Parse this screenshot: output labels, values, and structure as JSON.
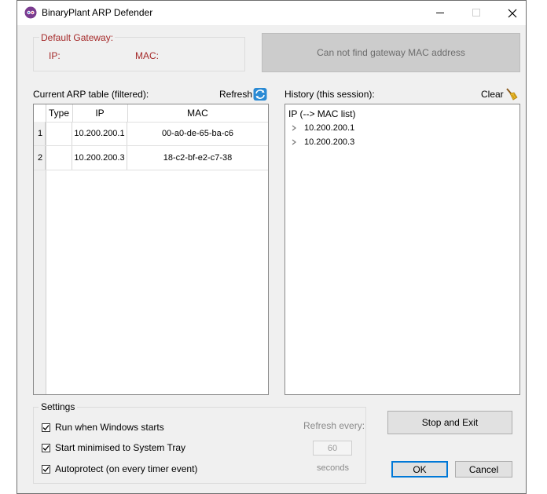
{
  "window": {
    "title": "BinaryPlant ARP Defender"
  },
  "gateway": {
    "legend": "Default Gateway:",
    "ip_label": "IP:",
    "mac_label": "MAC:",
    "status_message": "Can not find gateway MAC address"
  },
  "arp_table": {
    "label": "Current ARP table (filtered):",
    "refresh_label": "Refresh",
    "columns": {
      "type": "Type",
      "ip": "IP",
      "mac": "MAC"
    },
    "rows": [
      {
        "num": "1",
        "type": "",
        "ip": "10.200.200.1",
        "mac": "00-a0-de-65-ba-c6"
      },
      {
        "num": "2",
        "type": "",
        "ip": "10.200.200.3",
        "mac": "18-c2-bf-e2-c7-38"
      }
    ]
  },
  "history": {
    "label": "History (this session):",
    "clear_label": "Clear",
    "root_label": "IP (--> MAC list)",
    "items": [
      "10.200.200.1",
      "10.200.200.3"
    ]
  },
  "settings": {
    "legend": "Settings",
    "run_on_start": {
      "label": "Run when Windows starts",
      "checked": true
    },
    "start_minimised": {
      "label": "Start minimised to System Tray",
      "checked": true
    },
    "autoprotect": {
      "label": "Autoprotect (on every timer event)",
      "checked": true
    },
    "refresh_every_label": "Refresh every:",
    "refresh_interval": "60",
    "seconds_label": "seconds"
  },
  "buttons": {
    "stop_and_exit": "Stop and Exit",
    "ok": "OK",
    "cancel": "Cancel"
  },
  "colors": {
    "accent": "#0078d7",
    "gateway_label": "#a52a2a",
    "status_box_bg": "#cccccc",
    "window_bg": "#f0f0f0"
  },
  "icons": {
    "app": "app-logo-icon",
    "refresh": "refresh-icon",
    "clear": "broom-icon",
    "expand": "chevron-right-icon"
  }
}
